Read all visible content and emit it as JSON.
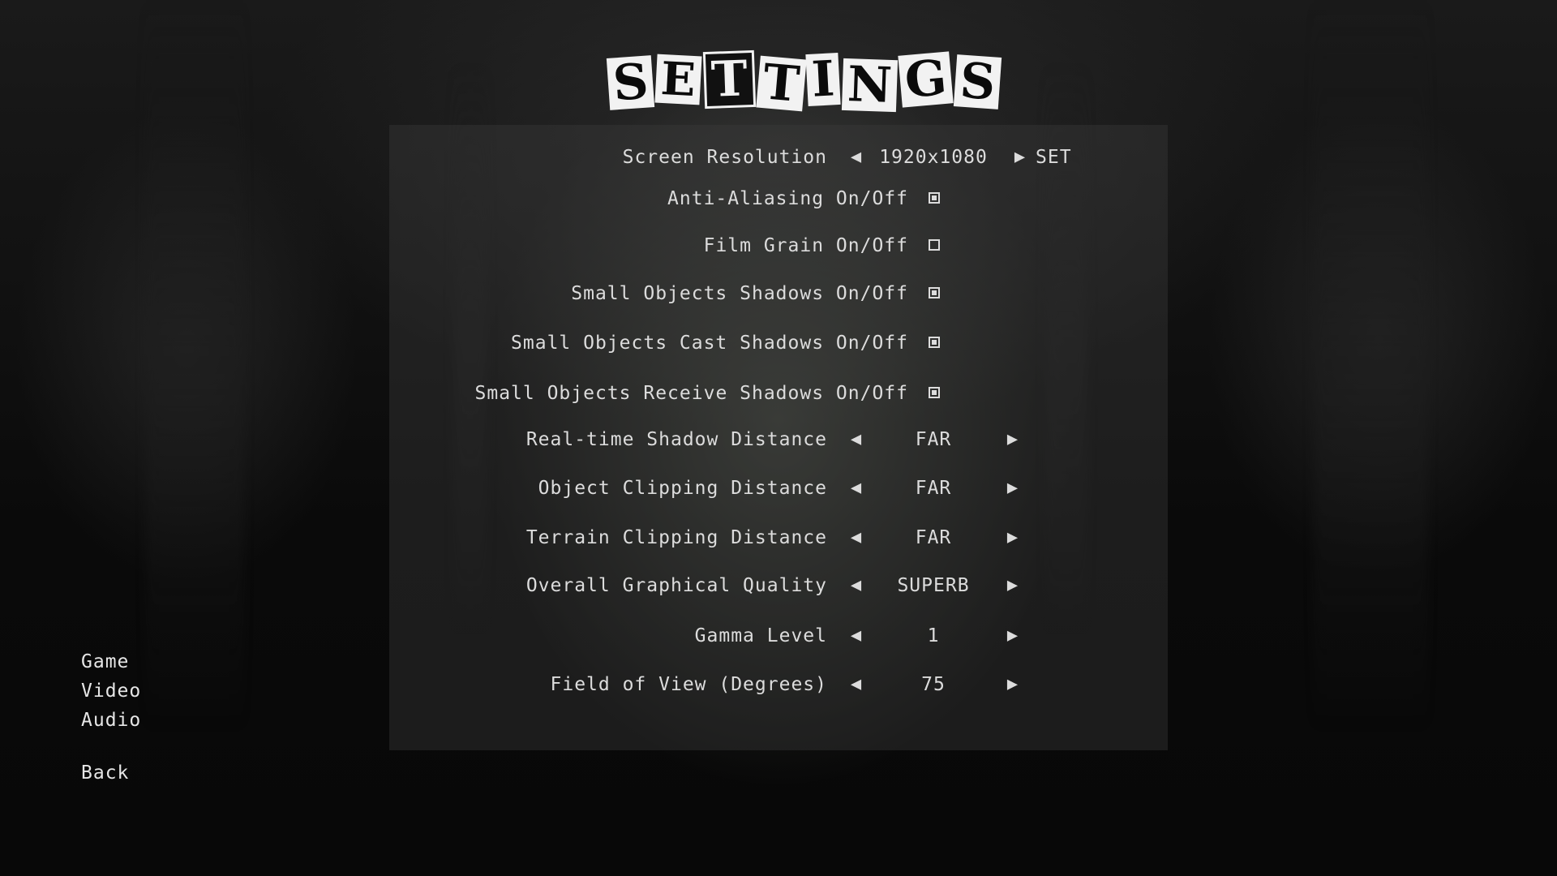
{
  "title": "SETTINGS",
  "title_letters": [
    "S",
    "E",
    "T",
    "T",
    "I",
    "N",
    "G",
    "S"
  ],
  "settings": {
    "screen_resolution": {
      "label": "Screen Resolution",
      "value": "1920x1080",
      "set_label": "SET"
    },
    "toggles": [
      {
        "label": "Anti-Aliasing On/Off",
        "checked": true
      },
      {
        "label": "Film Grain On/Off",
        "checked": false
      },
      {
        "label": "Small Objects Shadows On/Off",
        "checked": true
      },
      {
        "label": "Small Objects Cast Shadows On/Off",
        "checked": true
      },
      {
        "label": "Small Objects Receive Shadows On/Off",
        "checked": true
      }
    ],
    "selectors": [
      {
        "label": "Real-time Shadow Distance",
        "value": "FAR"
      },
      {
        "label": "Object Clipping Distance",
        "value": "FAR"
      },
      {
        "label": "Terrain Clipping Distance",
        "value": "FAR"
      },
      {
        "label": "Overall Graphical Quality",
        "value": "SUPERB"
      },
      {
        "label": "Gamma Level",
        "value": "1"
      },
      {
        "label": "Field of View (Degrees)",
        "value": "75"
      }
    ]
  },
  "arrows": {
    "left": "◀",
    "right": "▶"
  },
  "nav": {
    "game": "Game",
    "video": "Video",
    "audio": "Audio",
    "back": "Back"
  }
}
